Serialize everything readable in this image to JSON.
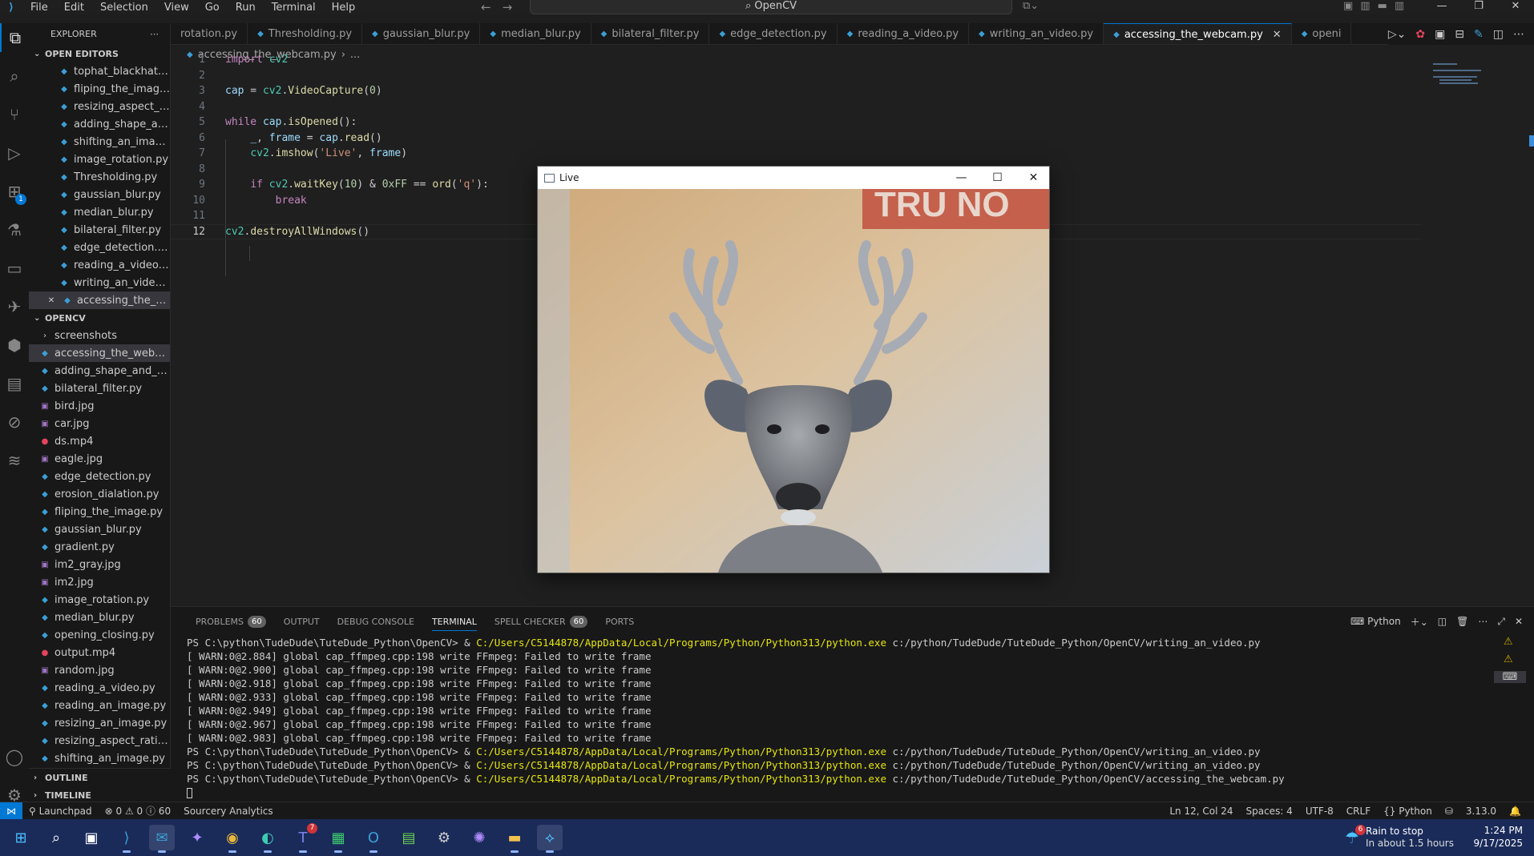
{
  "titlebar": {
    "menus": [
      "File",
      "Edit",
      "Selection",
      "View",
      "Go",
      "Run",
      "Terminal",
      "Help"
    ],
    "search_text": "OpenCV"
  },
  "sidebar": {
    "title": "EXPLORER",
    "open_editors_label": "OPEN EDITORS",
    "open_editors": [
      "tophat_blackhat.py",
      "fliping_the_image.py",
      "resizing_aspect_ration.py",
      "adding_shape_and_text.py",
      "shifting_an_image.py",
      "image_rotation.py",
      "Thresholding.py",
      "gaussian_blur.py",
      "median_blur.py",
      "bilateral_filter.py",
      "edge_detection.py",
      "reading_a_video.py",
      "writing_an_video.py",
      "accessing_the_webcam.py"
    ],
    "folder_label": "OPENCV",
    "files": [
      {
        "name": "screenshots",
        "type": "folder"
      },
      {
        "name": "accessing_the_webcam.py",
        "type": "py"
      },
      {
        "name": "adding_shape_and_text.py",
        "type": "py"
      },
      {
        "name": "bilateral_filter.py",
        "type": "py"
      },
      {
        "name": "bird.jpg",
        "type": "jpg"
      },
      {
        "name": "car.jpg",
        "type": "jpg"
      },
      {
        "name": "ds.mp4",
        "type": "mp4"
      },
      {
        "name": "eagle.jpg",
        "type": "jpg"
      },
      {
        "name": "edge_detection.py",
        "type": "py"
      },
      {
        "name": "erosion_dialation.py",
        "type": "py"
      },
      {
        "name": "fliping_the_image.py",
        "type": "py"
      },
      {
        "name": "gaussian_blur.py",
        "type": "py"
      },
      {
        "name": "gradient.py",
        "type": "py"
      },
      {
        "name": "im2_gray.jpg",
        "type": "jpg"
      },
      {
        "name": "im2.jpg",
        "type": "jpg"
      },
      {
        "name": "image_rotation.py",
        "type": "py"
      },
      {
        "name": "median_blur.py",
        "type": "py"
      },
      {
        "name": "opening_closing.py",
        "type": "py"
      },
      {
        "name": "output.mp4",
        "type": "mp4"
      },
      {
        "name": "random.jpg",
        "type": "jpg"
      },
      {
        "name": "reading_a_video.py",
        "type": "py"
      },
      {
        "name": "reading_an_image.py",
        "type": "py"
      },
      {
        "name": "resizing_an_image.py",
        "type": "py"
      },
      {
        "name": "resizing_aspect_ration.py",
        "type": "py"
      },
      {
        "name": "shifting_an_image.py",
        "type": "py"
      }
    ],
    "outline_label": "OUTLINE",
    "timeline_label": "TIMELINE"
  },
  "activity_badge": "1",
  "tabs": [
    {
      "label": "rotation.py",
      "active": false
    },
    {
      "label": "Thresholding.py",
      "active": false
    },
    {
      "label": "gaussian_blur.py",
      "active": false
    },
    {
      "label": "median_blur.py",
      "active": false
    },
    {
      "label": "bilateral_filter.py",
      "active": false
    },
    {
      "label": "edge_detection.py",
      "active": false
    },
    {
      "label": "reading_a_video.py",
      "active": false
    },
    {
      "label": "writing_an_video.py",
      "active": false
    },
    {
      "label": "accessing_the_webcam.py",
      "active": true
    },
    {
      "label": "openi",
      "active": false
    }
  ],
  "breadcrumb": {
    "file": "accessing_the_webcam.py",
    "rest": "..."
  },
  "editor": {
    "current_line": 12,
    "lines": [
      "import cv2",
      "",
      "cap = cv2.VideoCapture(0)",
      "",
      "while cap.isOpened():",
      "    _, frame = cap.read()",
      "    cv2.imshow('Live', frame)",
      "",
      "    if cv2.waitKey(10) & 0xFF == ord('q'):",
      "        break",
      "",
      "cv2.destroyAllWindows()"
    ]
  },
  "live_window": {
    "title": "Live",
    "sign_text": "TRU NO"
  },
  "panel": {
    "tabs": [
      {
        "label": "PROBLEMS",
        "badge": "60"
      },
      {
        "label": "OUTPUT",
        "badge": ""
      },
      {
        "label": "DEBUG CONSOLE",
        "badge": ""
      },
      {
        "label": "TERMINAL",
        "badge": ""
      },
      {
        "label": "SPELL CHECKER",
        "badge": "60"
      },
      {
        "label": "PORTS",
        "badge": ""
      }
    ],
    "shell_label": "Python",
    "terminal_lines": [
      {
        "prompt": "PS C:\\python\\TudeDude\\TuteDude_Python\\OpenCV> & ",
        "exe": "C:/Users/C5144878/AppData/Local/Programs/Python/Python313/python.exe",
        "arg": " c:/python/TudeDude/TuteDude_Python/OpenCV/writing_an_video.py",
        "dot": ""
      },
      {
        "text": "[ WARN:0@2.884] global cap_ffmpeg.cpp:198 write FFmpeg: Failed to write frame"
      },
      {
        "text": "[ WARN:0@2.900] global cap_ffmpeg.cpp:198 write FFmpeg: Failed to write frame"
      },
      {
        "text": "[ WARN:0@2.918] global cap_ffmpeg.cpp:198 write FFmpeg: Failed to write frame"
      },
      {
        "text": "[ WARN:0@2.933] global cap_ffmpeg.cpp:198 write FFmpeg: Failed to write frame"
      },
      {
        "text": "[ WARN:0@2.949] global cap_ffmpeg.cpp:198 write FFmpeg: Failed to write frame"
      },
      {
        "text": "[ WARN:0@2.967] global cap_ffmpeg.cpp:198 write FFmpeg: Failed to write frame"
      },
      {
        "text": "[ WARN:0@2.983] global cap_ffmpeg.cpp:198 write FFmpeg: Failed to write frame"
      },
      {
        "prompt": "PS C:\\python\\TudeDude\\TuteDude_Python\\OpenCV> & ",
        "exe": "C:/Users/C5144878/AppData/Local/Programs/Python/Python313/python.exe",
        "arg": " c:/python/TudeDude/TuteDude_Python/OpenCV/writing_an_video.py",
        "dot": ""
      },
      {
        "prompt": "PS C:\\python\\TudeDude\\TuteDude_Python\\OpenCV> & ",
        "exe": "C:/Users/C5144878/AppData/Local/Programs/Python/Python313/python.exe",
        "arg": " c:/python/TudeDude/TuteDude_Python/OpenCV/writing_an_video.py",
        "dot": "blue"
      },
      {
        "prompt": "PS C:\\python\\TudeDude\\TuteDude_Python\\OpenCV> & ",
        "exe": "C:/Users/C5144878/AppData/Local/Programs/Python/Python313/python.exe",
        "arg": " c:/python/TudeDude/TuteDude_Python/OpenCV/accessing_the_webcam.py",
        "dot": "gray"
      }
    ]
  },
  "statusbar": {
    "launchpad": "Launchpad",
    "problems": "⊗ 0 ⚠ 0 ⓘ 60",
    "sourcery": "Sourcery Analytics",
    "position": "Ln 12, Col 24",
    "spaces": "Spaces: 4",
    "encoding": "UTF-8",
    "eol": "CRLF",
    "language": "Python",
    "version": "3.13.0"
  },
  "taskbar": {
    "teams_badge": "7",
    "weather_badge": "6",
    "weather_title": "Rain to stop",
    "weather_sub": "In about 1.5 hours",
    "time": "1:24 PM",
    "date": "9/17/2025"
  },
  "colors": {
    "accent": "#0078d4",
    "python_icon": "#3b9fd6",
    "image_icon": "#a074c4",
    "video_icon": "#e2445c",
    "terminal_path": "#e5e510",
    "taskbar": "#1a2b5a"
  }
}
